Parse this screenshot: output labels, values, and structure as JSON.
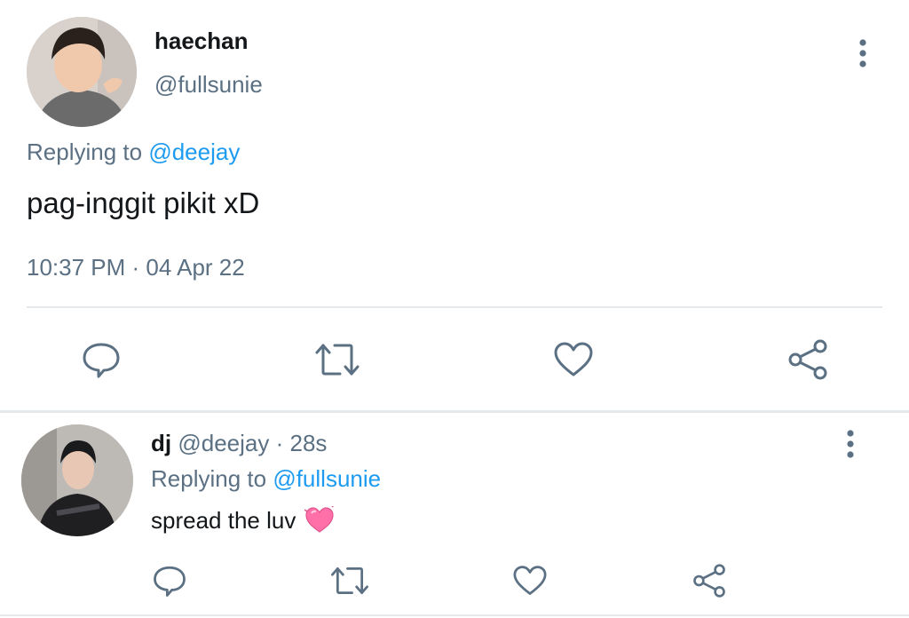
{
  "main_tweet": {
    "display_name": "haechan",
    "handle": "@fullsunie",
    "replying_prefix": "Replying to",
    "replying_handle": "@deejay",
    "text": "pag-inggit pikit xD",
    "timestamp": "10:37 PM · 04 Apr 22",
    "actions": [
      "reply-icon",
      "retweet-icon",
      "like-icon",
      "share-icon"
    ],
    "more_icon": "more-vertical-icon"
  },
  "reply_tweet": {
    "display_name": "dj",
    "handle": "@deejay",
    "separator": "·",
    "age": "28s",
    "replying_prefix": "Replying to",
    "replying_handle": "@fullsunie",
    "text": "spread the luv",
    "emoji": "💓",
    "actions": [
      "reply-icon",
      "retweet-icon",
      "like-icon",
      "share-icon"
    ],
    "more_icon": "more-vertical-icon"
  },
  "colors": {
    "text": "#14171a",
    "muted": "#5b7083",
    "link": "#1d9bf0",
    "divider": "#e6e9ec",
    "emoji_pink": "#ff6fa8"
  }
}
